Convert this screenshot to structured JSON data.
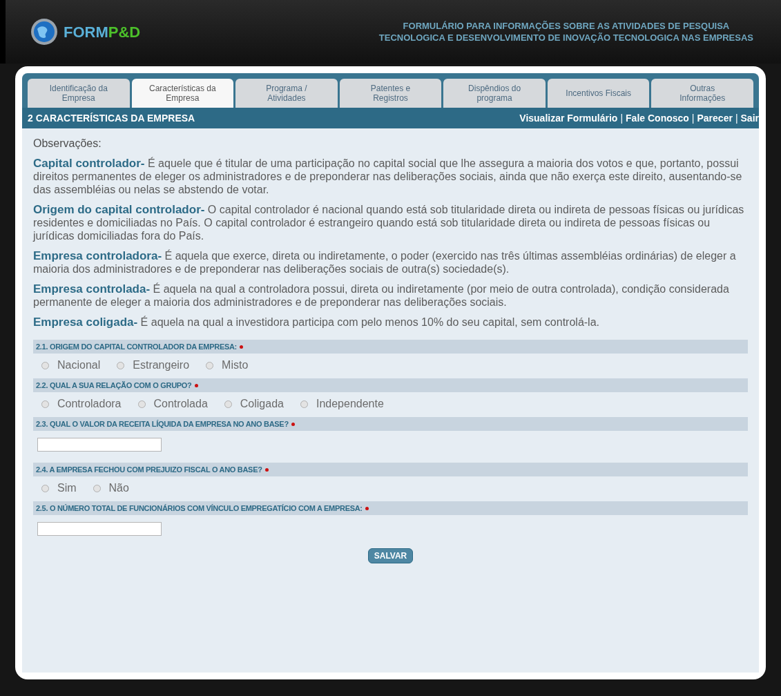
{
  "header": {
    "logo_text_1": "FORM",
    "logo_text_2": "P&D",
    "title_lines": [
      "FORMULÁRIO PARA INFORMAÇÕES SOBRE AS ATIVIDADES DE PESQUISA",
      "TECNOLOGICA E DESENVOLVIMENTO DE INOVAÇÃO TECNOLOGICA NAS EMPRESAS"
    ]
  },
  "tabs": [
    {
      "label": "Identificação da Empresa",
      "selected": false
    },
    {
      "label": "Características da Empresa",
      "selected": true
    },
    {
      "label": "Programa / Atividades",
      "selected": false
    },
    {
      "label": "Patentes e Registros",
      "selected": false
    },
    {
      "label": "Dispêndios do programa",
      "selected": false
    },
    {
      "label": "Incentivos Fiscais",
      "selected": false
    },
    {
      "label": "Outras Informações",
      "selected": false
    }
  ],
  "section": {
    "title": "2 CARACTERÍSTICAS DA EMPRESA",
    "links": [
      {
        "kind": "link",
        "label": "Visualizar Formulário"
      },
      {
        "kind": "separator",
        "label": "|"
      },
      {
        "kind": "link",
        "label": "Fale Conosco"
      },
      {
        "kind": "separator",
        "label": "|"
      },
      {
        "kind": "link",
        "label": "Parecer"
      },
      {
        "kind": "separator",
        "label": "|"
      },
      {
        "kind": "link",
        "label": "Sair"
      }
    ]
  },
  "observations": {
    "title": "Observações:",
    "paragraphs": [
      "**Capital controlador-** É aquele que é titular de uma participação no capital social que lhe assegura a maioria dos votos e que, portanto, possui direitos permanentes de eleger os administradores e de preponderar nas deliberações sociais, ainda que não exerça este direito, ausentando-se das assembléias ou nelas se abstendo de votar.",
      "**Origem do capital controlador-** O capital controlador é nacional quando está sob titularidade direta ou indireta de pessoas físicas ou jurídicas residentes e domiciliadas no País. O capital controlador é estrangeiro quando está sob titularidade direta ou indireta de pessoas físicas ou jurídicas domiciliadas fora do País.",
      "**Empresa controladora-** É aquela que exerce, direta ou indiretamente, o poder (exercido nas três últimas assembléias ordinárias) de eleger a maioria dos administradores e de preponderar nas deliberações sociais de outra(s) sociedade(s).",
      "**Empresa controlada-** É aquela na qual a controladora possui, direta ou indiretamente (por meio de outra controlada), condição considerada permanente de eleger a maioria dos administradores e de preponderar nas deliberações sociais.",
      "**Empresa coligada-** É aquela na qual a investidora participa com pelo menos 10% do seu capital, sem controlá-la."
    ]
  },
  "questions": [
    {
      "kind": "radio",
      "label": "2.1. ORIGEM DO CAPITAL CONTROLADOR DA EMPRESA:",
      "required": true,
      "options": [
        {
          "label": "Nacional",
          "selected": false
        },
        {
          "label": "Estrangeiro",
          "selected": false
        },
        {
          "label": "Misto",
          "selected": false
        }
      ]
    },
    {
      "kind": "radio",
      "label": "2.2. QUAL A SUA RELAÇÃO COM O GRUPO?",
      "required": true,
      "options": [
        {
          "label": "Controladora",
          "selected": false
        },
        {
          "label": "Controlada",
          "selected": false
        },
        {
          "label": "Coligada",
          "selected": false
        },
        {
          "label": "Independente",
          "selected": false
        }
      ]
    },
    {
      "kind": "text",
      "label": "2.3. QUAL O VALOR DA RECEITA LÍQUIDA DA EMPRESA NO ANO BASE?",
      "required": true
    },
    {
      "kind": "radio",
      "label": "2.4. A EMPRESA FECHOU COM PREJUIZO FISCAL O ANO BASE?",
      "required": true,
      "options": [
        {
          "label": "Sim",
          "selected": false
        },
        {
          "label": "Não",
          "selected": false
        }
      ]
    },
    {
      "kind": "text",
      "label": "2.5. O NÚMERO TOTAL DE FUNCIONÁRIOS COM VÍNCULO EMPREGATÍCIO COM A EMPRESA:",
      "required": true
    }
  ],
  "save_button": "SALVAR"
}
